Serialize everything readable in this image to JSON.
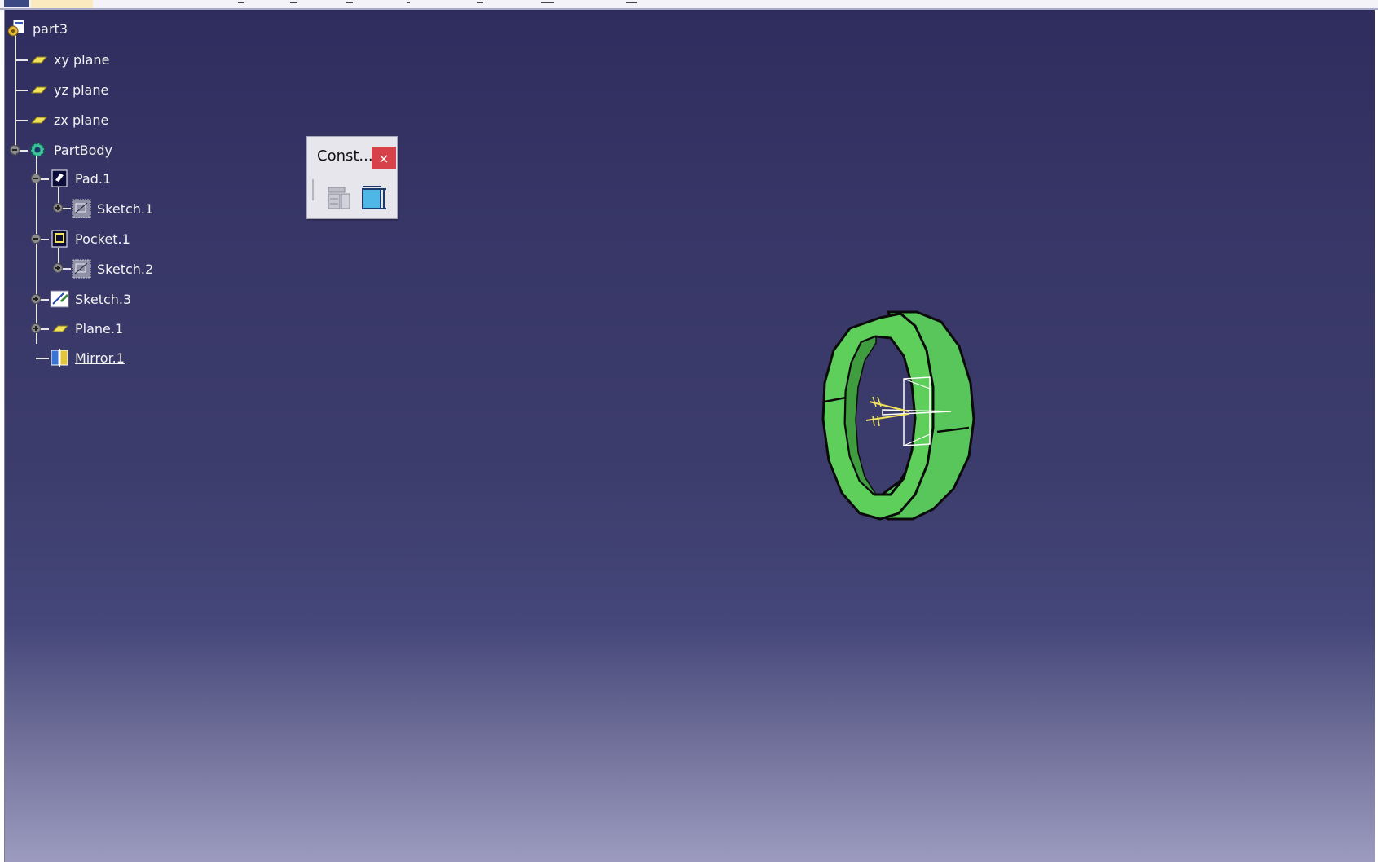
{
  "tree": {
    "root": "part3",
    "items": [
      {
        "label": "xy plane",
        "icon": "plane-icon"
      },
      {
        "label": "yz plane",
        "icon": "plane-icon"
      },
      {
        "label": "zx plane",
        "icon": "plane-icon"
      },
      {
        "label": "PartBody",
        "icon": "body-gear-icon"
      },
      {
        "label": "Pad.1",
        "icon": "pad-icon"
      },
      {
        "label": "Sketch.1",
        "icon": "sketch-icon"
      },
      {
        "label": "Pocket.1",
        "icon": "pocket-icon"
      },
      {
        "label": "Sketch.2",
        "icon": "sketch-icon"
      },
      {
        "label": "Sketch.3",
        "icon": "sketch-edit-icon"
      },
      {
        "label": "Plane.1",
        "icon": "plane-icon"
      },
      {
        "label": "Mirror.1",
        "icon": "mirror-icon"
      }
    ]
  },
  "toolbar": {
    "title": "Const...",
    "close_label": "×",
    "buttons": [
      "constraints-table-icon",
      "constraint-dimension-icon"
    ]
  },
  "colors": {
    "background_top": "#2f2d5e",
    "background_bottom": "#9c9bbf",
    "part_green": "#58c65a",
    "close_red": "#d7414a",
    "plane_yellow": "#f2e35c"
  }
}
